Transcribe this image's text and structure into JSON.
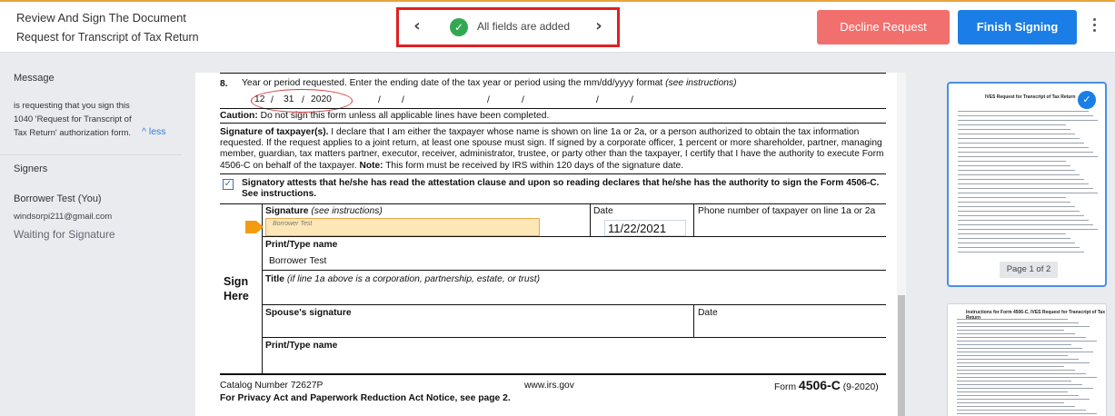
{
  "header": {
    "title": "Review And Sign The Document",
    "subtitle": "Request for Transcript of Tax Return",
    "nav_status": "All fields are added",
    "prev_icon": "chevron-left-icon",
    "next_icon": "chevron-right-icon",
    "decline_label": "Decline Request",
    "finish_label": "Finish Signing",
    "colors": {
      "decline": "#f1706e",
      "finish": "#1a7ee6",
      "status_ok": "#33a852"
    }
  },
  "sidebar": {
    "message_heading": "Message",
    "message_text": "is requesting that you sign this 1040 'Request for Transcript of Tax Return' authorization form.",
    "less_label": "less",
    "signers_heading": "Signers",
    "signer_name": "Borrower Test (You)",
    "signer_email": "windsorpi211@gmail.com",
    "signer_status": "Waiting for Signature"
  },
  "document": {
    "line8_num": "8.",
    "line8_text": "Year or period requested. Enter the ending date of the tax year or period using the mm/dd/yyyy format",
    "line8_note": "(see instructions)",
    "date_month": "12",
    "date_day": "31",
    "date_year": "2020",
    "caution_label": "Caution:",
    "caution_text": "Do not sign this form unless all applicable lines have been completed.",
    "sig_taxpayer_label": "Signature of taxpayer(s).",
    "sig_taxpayer_text": "I declare that I am either the taxpayer whose name is shown on line 1a or 2a, or a person authorized to obtain the tax information requested. If the request applies to a joint return, at least one spouse must sign. If signed by a corporate officer, 1 percent or more shareholder, partner, managing member, guardian, tax matters partner, executor, receiver, administrator, trustee, or party other than the taxpayer, I certify that I have the authority to execute Form 4506-C on behalf of the taxpayer.",
    "note_label": "Note:",
    "note_text": "This form must be received by IRS within 120 days of the signature date.",
    "attest_text": "Signatory attests that he/she has read the attestation clause and upon so reading declares that he/she has the authority to sign the Form 4506-C. See instructions.",
    "attest_checked": true,
    "sign_here_1": "Sign",
    "sign_here_2": "Here",
    "signature_label": "Signature",
    "signature_note": "(see instructions)",
    "signature_value": "Borrower Test",
    "date_label": "Date",
    "date_value": "11/22/2021",
    "phone_label": "Phone number of taxpayer on line 1a or 2a",
    "print_label": "Print/Type name",
    "print_value": "Borrower Test",
    "title_label": "Title",
    "title_note": "(if line 1a above is a corporation, partnership, estate, or trust)",
    "spouse_label": "Spouse's signature",
    "spouse_date_label": "Date",
    "print2_label": "Print/Type name",
    "catalog": "Catalog Number 72627P",
    "website": "www.irs.gov",
    "form_prefix": "Form",
    "form_number": "4506-C",
    "form_date": "(9-2020)",
    "privacy": "For Privacy Act and Paperwork Reduction Act Notice, see page 2."
  },
  "thumbnails": {
    "page1_title": "IVES Request for Transcript of Tax Return",
    "page_label": "Page 1 of 2",
    "page2_title": "Instructions for Form 4506-C, IVES Request for Transcript of Tax Return"
  }
}
